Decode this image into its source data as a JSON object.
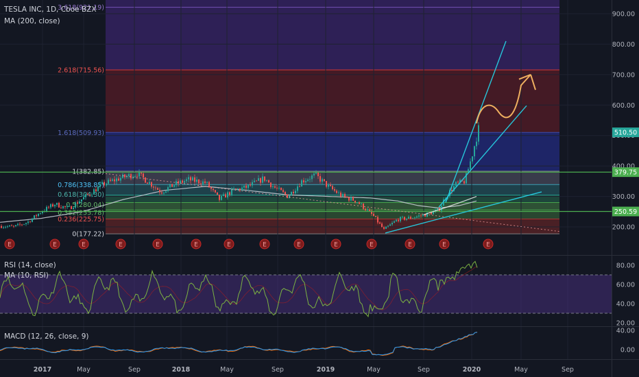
{
  "header": {
    "symbol": "TESLA INC, 1D, Cboe BZX",
    "ma_label": "MA (200, close)",
    "rsi_label": "RSI (14, close)",
    "rsi_ma_label": "MA (10, RSI)",
    "macd_label": "MACD (12, 26, close, 9)"
  },
  "colors": {
    "background": "#131722",
    "grid": "#1e2230",
    "axis_text": "#b2b5be",
    "price_line": "#2ebd85",
    "hline": "#4caf50",
    "trend": "#26c6da",
    "arrow": "#f0b060",
    "ma": "#cfd3dc",
    "rsi": "#7cb342",
    "macd": "#2196f3",
    "signal": "#ff6d00",
    "earnings_bg": "#7d1c1c",
    "earnings_text": "#ef9a9a"
  },
  "chart_data": {
    "type": "candlestick",
    "x_axis_labels": [
      "2017",
      "May",
      "Sep",
      "2018",
      "May",
      "Sep",
      "2019",
      "May",
      "Sep",
      "2020",
      "May",
      "Sep"
    ],
    "y_axis_labels": [
      "900.00",
      "800.00",
      "700.00",
      "600.00",
      "500.00",
      "400.00",
      "300.00",
      "200.00"
    ],
    "y_range": [
      170,
      935
    ],
    "fib_levels": [
      {
        "label": "0(177.22)",
        "ratio": "0",
        "value": 177.22
      },
      {
        "label": "0.236(225.75)",
        "ratio": "0.236",
        "value": 225.75
      },
      {
        "label": "0.382(255.78)",
        "ratio": "0.382",
        "value": 255.78
      },
      {
        "label": "0.5(280.04)",
        "ratio": "0.5",
        "value": 280.04
      },
      {
        "label": "0.618(304.30)",
        "ratio": "0.618",
        "value": 304.3
      },
      {
        "label": "0.786(338.85)",
        "ratio": "0.786",
        "value": 338.85
      },
      {
        "label": "1(382.85)",
        "ratio": "1",
        "value": 382.85
      },
      {
        "label": "1.618(509.93)",
        "ratio": "1.618",
        "value": 509.93
      },
      {
        "label": "2.618(715.56)",
        "ratio": "2.618",
        "value": 715.56
      },
      {
        "label": "3.618(921.19)",
        "ratio": "3.618",
        "value": 921.19
      }
    ],
    "horizontal_lines": [
      379.75,
      250.59
    ],
    "price_badges": [
      {
        "label": "510.50",
        "value": 510.5,
        "color": "#26a69a"
      },
      {
        "label": "379.75",
        "value": 379.75,
        "color": "#4caf50"
      },
      {
        "label": "250.59",
        "value": 250.59,
        "color": "#4caf50"
      }
    ],
    "earnings_marker": "E",
    "earnings_count": 14,
    "rsi_axis_labels": [
      "80.00",
      "60.00",
      "40.00",
      "20.00"
    ],
    "rsi_range": [
      15,
      92
    ],
    "rsi_bands": [
      30,
      70
    ],
    "macd_axis_labels": [
      "40.00",
      "0.00"
    ],
    "macd_range": [
      -22,
      42
    ]
  }
}
